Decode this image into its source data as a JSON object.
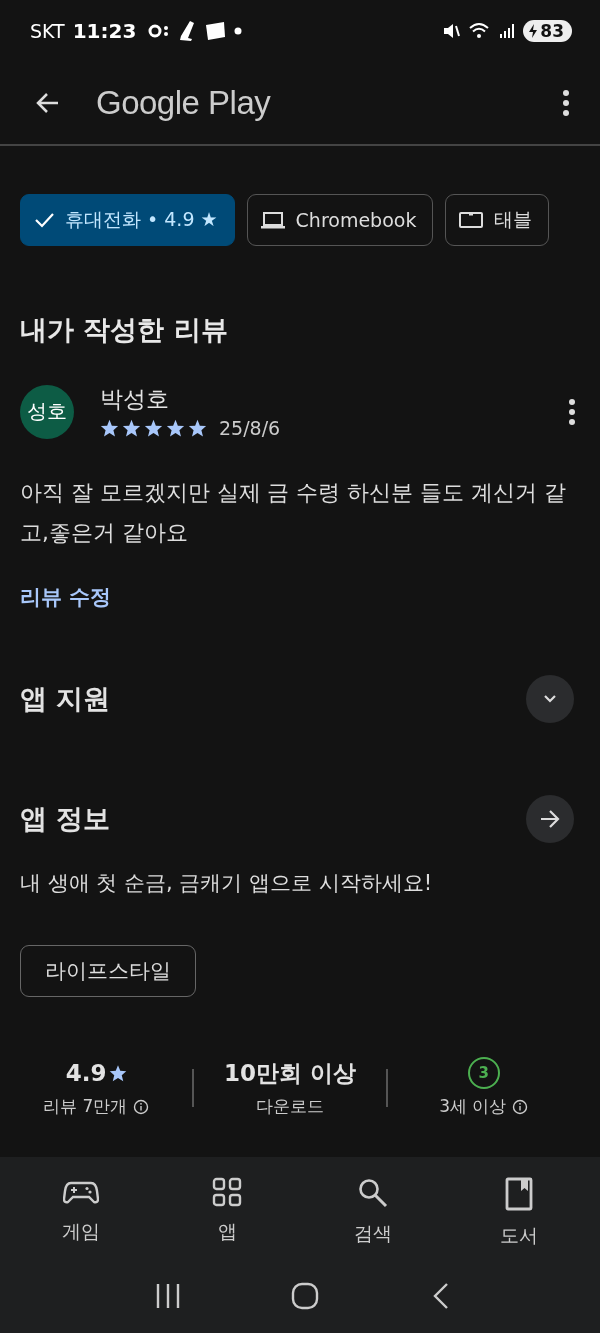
{
  "status_bar": {
    "carrier": "SKT",
    "time": "11:23",
    "battery": "83"
  },
  "header": {
    "title": "Google Play"
  },
  "device_chips": [
    {
      "label": "휴대전화 • 4.9 ★",
      "selected": true
    },
    {
      "label": "Chromebook",
      "selected": false,
      "kind": "laptop"
    },
    {
      "label": "태블",
      "selected": false,
      "kind": "tablet"
    }
  ],
  "my_review": {
    "heading": "내가 작성한 리뷰",
    "avatar": "성호",
    "author": "박성호",
    "stars": 5,
    "date": "25/8/6",
    "text": "아직 잘 모르겠지만 실제 금 수령 하신분 들도 계신거 같고,좋은거 같아요",
    "edit_link": "리뷰 수정"
  },
  "sections": [
    {
      "title": "앱 지원",
      "kind": "expand"
    },
    {
      "title": "앱 정보",
      "kind": "navigate"
    }
  ],
  "description": "내 생애 첫 순금, 금캐기 앱으로 시작하세요!",
  "category_tag": "라이프스타일",
  "stats": [
    {
      "kind": "rating",
      "value": "4.9",
      "label": "리뷰 7만개",
      "info": true
    },
    {
      "kind": "plain",
      "value": "10만회 이상",
      "label": "다운로드",
      "info": false
    },
    {
      "kind": "age",
      "value": "3",
      "label": "3세 이상",
      "info": true
    }
  ],
  "bottom_nav": [
    {
      "label": "게임",
      "kind": "games",
      "selected": false
    },
    {
      "label": "앱",
      "kind": "apps",
      "selected": false
    },
    {
      "label": "검색",
      "kind": "search",
      "selected": false
    },
    {
      "label": "도서",
      "kind": "books",
      "selected": false
    }
  ]
}
